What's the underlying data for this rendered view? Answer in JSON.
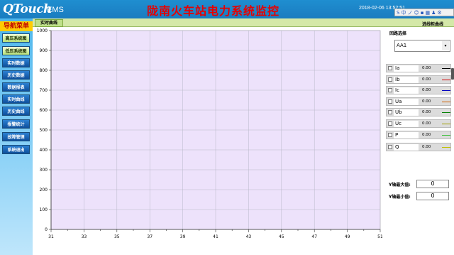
{
  "header": {
    "logo": "QTouch",
    "logo_sub": "EMS",
    "title": "陇南火车站电力系统监控",
    "datetime": "2018-02-06 13:52:51",
    "ime_items": [
      "S",
      "中",
      "ノ",
      "☺",
      "▪",
      "▦",
      "♟",
      "⚙"
    ]
  },
  "nav": {
    "title": "导航菜单",
    "items": [
      {
        "label": "高压系统图",
        "style": "g"
      },
      {
        "label": "低压系统图",
        "style": "g"
      },
      {
        "label": "实时数据",
        "style": "b"
      },
      {
        "label": "历史数据",
        "style": "b"
      },
      {
        "label": "数据报表",
        "style": "b"
      },
      {
        "label": "实时曲线",
        "style": "b"
      },
      {
        "label": "历史曲线",
        "style": "b"
      },
      {
        "label": "报警统计",
        "style": "b"
      },
      {
        "label": "故障管理",
        "style": "b"
      },
      {
        "label": "系统退出",
        "style": "b"
      }
    ]
  },
  "tab": {
    "label": "实时曲线"
  },
  "crumb": "进线柜曲线",
  "right": {
    "circuit_label": "回路选择",
    "circuit_value": "AA1",
    "selector_arrow": "▾",
    "series": [
      {
        "name": "Ia",
        "value": "0.00",
        "color": "#000000"
      },
      {
        "name": "Ib",
        "value": "0.00",
        "color": "#d00000"
      },
      {
        "name": "Ic",
        "value": "0.00",
        "color": "#0000c0"
      },
      {
        "name": "Ua",
        "value": "0.00",
        "color": "#d06000"
      },
      {
        "name": "Ub",
        "value": "0.00",
        "color": "#008000"
      },
      {
        "name": "Uc",
        "value": "0.00",
        "color": "#a0a000"
      },
      {
        "name": "P",
        "value": "0.00",
        "color": "#40c040"
      },
      {
        "name": "Q",
        "value": "0.00",
        "color": "#c0c000"
      }
    ],
    "ymax_label": "Y轴最大值:",
    "ymax": "0",
    "ymin_label": "Y轴最小值:",
    "ymin": "0"
  },
  "chart_data": {
    "type": "line",
    "x_ticks": [
      "31",
      "33",
      "35",
      "37",
      "39",
      "41",
      "43",
      "45",
      "47",
      "49",
      "51"
    ],
    "y_ticks": [
      "0",
      "100",
      "200",
      "300",
      "400",
      "500",
      "600",
      "700",
      "800",
      "900",
      "1000"
    ],
    "xlim": [
      31,
      51
    ],
    "ylim": [
      0,
      1000
    ],
    "grid": true,
    "series": []
  }
}
